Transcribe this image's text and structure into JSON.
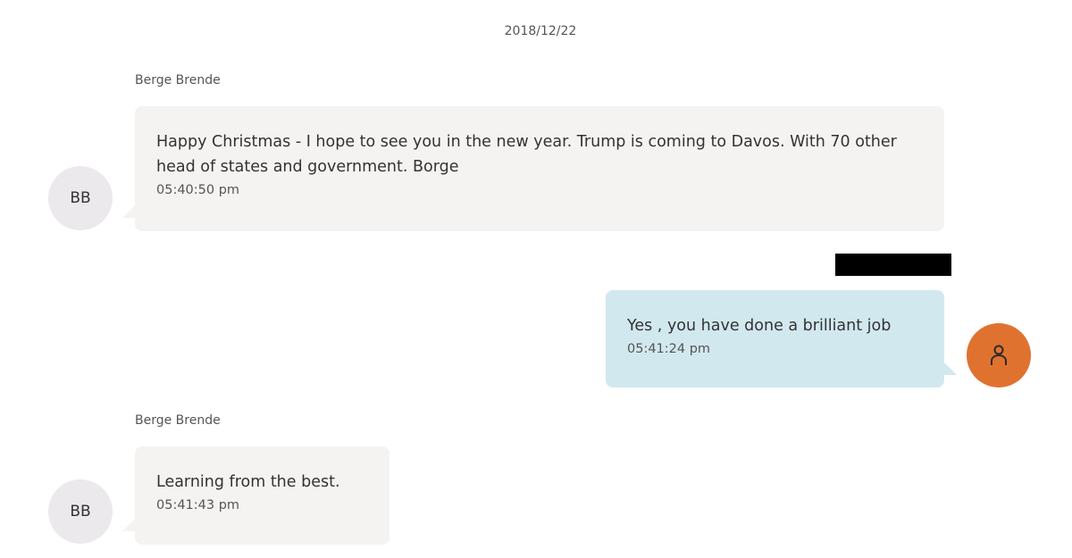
{
  "conversation": {
    "date": "2018/12/22",
    "messages": [
      {
        "direction": "incoming",
        "sender": "Berge Brende",
        "avatar_initials": "BB",
        "text": "Happy Christmas - I hope to see you in the new year. Trump is coming to Davos. With 70 other head of states and government. Borge",
        "time": "05:40:50 pm"
      },
      {
        "direction": "outgoing",
        "sender_redacted": true,
        "avatar_icon": "user-icon",
        "text": "Yes , you have done a brilliant job",
        "time": "05:41:24 pm"
      },
      {
        "direction": "incoming",
        "sender": "Berge Brende",
        "avatar_initials": "BB",
        "text": "Learning from the best.",
        "time": "05:41:43 pm"
      }
    ]
  },
  "colors": {
    "incoming_bubble": "#f4f3f1",
    "outgoing_bubble": "#d2e8ef",
    "initials_avatar": "#ebe9ec",
    "user_avatar": "#e07230"
  }
}
